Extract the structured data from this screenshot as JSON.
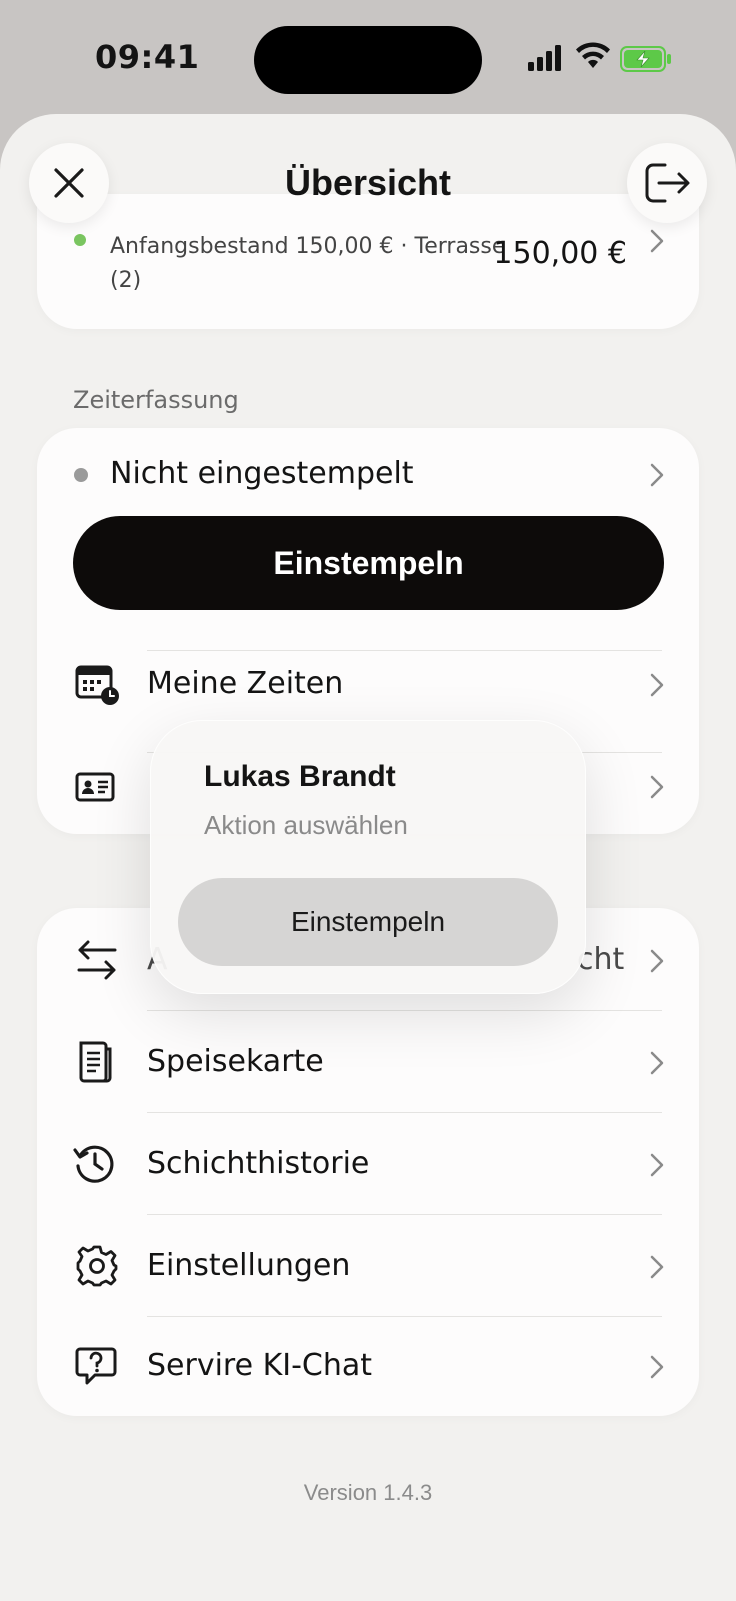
{
  "status_bar": {
    "time": "09:41"
  },
  "header": {
    "title": "Übersicht"
  },
  "cash_card": {
    "line1": "Anfangsbestand 150,00 € · Terrasse",
    "line2": "(2)",
    "amount": "150,00 €"
  },
  "time_section": {
    "label": "Zeiterfassung",
    "status": "Nicht eingestempelt",
    "stamp_button": "Einstempeln",
    "items": [
      {
        "label": "Meine Zeiten",
        "icon": "calendar-clock-icon"
      },
      {
        "label": "",
        "icon": "id-card-icon"
      }
    ]
  },
  "menu": {
    "items": [
      {
        "label": "A",
        "trailing": "cht",
        "icon": "swap-arrows-icon"
      },
      {
        "label": "Speisekarte",
        "icon": "menu-doc-icon"
      },
      {
        "label": "Schichthistorie",
        "icon": "history-icon"
      },
      {
        "label": "Einstellungen",
        "icon": "gear-icon"
      },
      {
        "label": "Servire KI-Chat",
        "icon": "chat-question-icon"
      }
    ]
  },
  "popup": {
    "name": "Lukas Brandt",
    "subtitle": "Aktion auswählen",
    "button": "Einstempeln"
  },
  "footer": {
    "version": "Version 1.4.3"
  },
  "colors": {
    "accent": "#0d0b0a",
    "status_green": "#7ac560",
    "battery_green": "#5dc948"
  }
}
